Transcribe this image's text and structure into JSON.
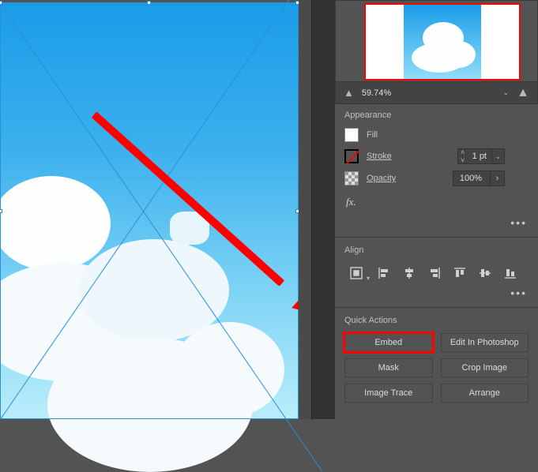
{
  "navigator": {
    "zoom": "59.74%"
  },
  "appearance": {
    "section": "Appearance",
    "fill_label": "Fill",
    "stroke_label": "Stroke",
    "stroke_value": "1 pt",
    "opacity_label": "Opacity",
    "opacity_value": "100%",
    "fx_label": "fx."
  },
  "align": {
    "section": "Align"
  },
  "quick_actions": {
    "section": "Quick Actions",
    "buttons": {
      "embed": "Embed",
      "edit_ps": "Edit In Photoshop",
      "mask": "Mask",
      "crop": "Crop Image",
      "trace": "Image Trace",
      "arrange": "Arrange"
    }
  },
  "more": "•••"
}
